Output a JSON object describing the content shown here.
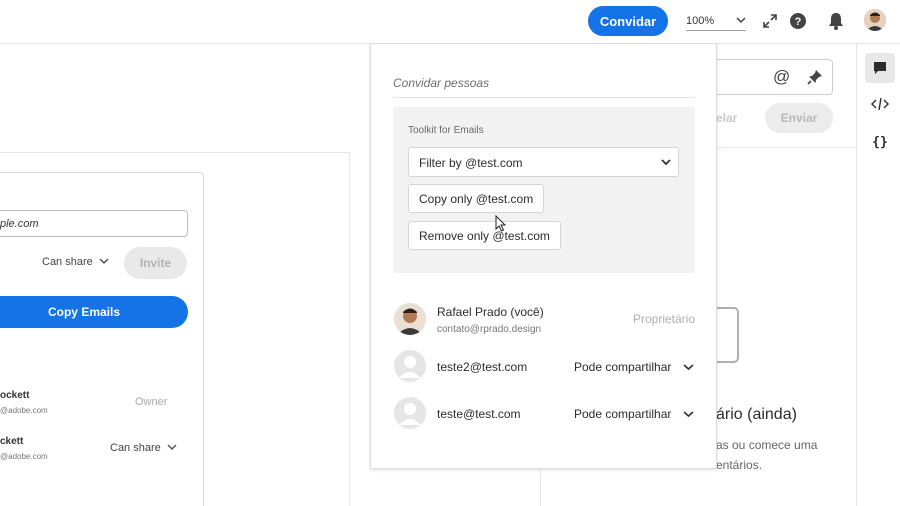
{
  "topbar": {
    "invite_label": "Convidar",
    "zoom_value": "100%"
  },
  "background_share": {
    "email_value": "ple.com",
    "permission": "Can share",
    "invite_label": "Invite",
    "copy_emails_label": "Copy Emails",
    "members": [
      {
        "name": "ockett",
        "email": "@adobe.com",
        "role": "Owner"
      },
      {
        "name": "ckett",
        "email": "@adobe.com",
        "role": "Can share"
      }
    ]
  },
  "comments_panel": {
    "cancel_label": "elar",
    "send_label": "Enviar",
    "empty_title": "ário (ainda)",
    "empty_line1": "as ou comece uma",
    "empty_line2": "entários."
  },
  "popover": {
    "title": "Convidar pessoas",
    "toolkit": {
      "label": "Toolkit for Emails",
      "filter_selected": "Filter by @test.com",
      "copy_only_label": "Copy only @test.com",
      "remove_only_label": "Remove only @test.com"
    },
    "people": [
      {
        "name": "Rafael Prado (você)",
        "email": "contato@rprado.design",
        "role": "Proprietário"
      },
      {
        "name": "teste2@test.com",
        "permission": "Pode compartilhar"
      },
      {
        "name": "teste@test.com",
        "permission": "Pode compartilhar"
      }
    ]
  },
  "colors": {
    "accent": "#1473e6",
    "toolkit_bg": "#f2f2f2",
    "disabled_bg": "#ececec"
  },
  "icons": [
    "fullscreen-icon",
    "help-icon",
    "bell-icon",
    "user-avatar",
    "comment-icon",
    "code-icon",
    "braces-icon",
    "at-icon",
    "pin-icon",
    "chevron-down-icon",
    "mouse-cursor"
  ]
}
